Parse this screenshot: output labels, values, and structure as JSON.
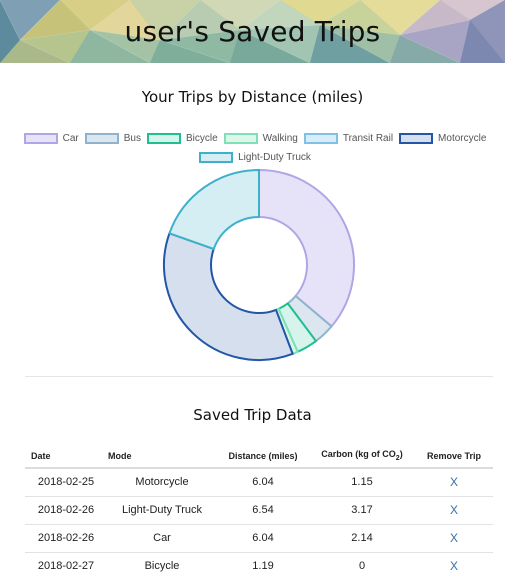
{
  "header": {
    "title": "user's Saved Trips"
  },
  "chart_section": {
    "title": "Your Trips by Distance (miles)"
  },
  "chart_data": {
    "type": "pie",
    "donut": true,
    "legend_position": "top",
    "categories": [
      "Car",
      "Bus",
      "Bicycle",
      "Walking",
      "Transit Rail",
      "Motorcycle",
      "Light-Duty Truck"
    ],
    "values": [
      12.08,
      1.2,
      1.19,
      0.3,
      0.0,
      12.08,
      6.54
    ],
    "colors": {
      "fill": [
        "#e6e3f8",
        "#dbe6ef",
        "#d6f4ec",
        "#dcf7ea",
        "#d9edf8",
        "#d5dfee",
        "#d5eef3"
      ],
      "stroke": [
        "#b0a6e6",
        "#8fb3cf",
        "#1fbf8f",
        "#7fe0b5",
        "#7ec1e6",
        "#2256a8",
        "#3fb0c9"
      ]
    }
  },
  "table_section": {
    "title": "Saved Trip Data"
  },
  "table": {
    "headers": {
      "date": "Date",
      "mode": "Mode",
      "distance": "Distance (miles)",
      "carbon_prefix": "Carbon (kg of CO",
      "carbon_sub": "2",
      "carbon_suffix": ")",
      "remove": "Remove Trip"
    },
    "rows": [
      {
        "date": "2018-02-25",
        "mode": "Motorcycle",
        "distance": "6.04",
        "carbon": "1.15",
        "remove": "X"
      },
      {
        "date": "2018-02-26",
        "mode": "Light-Duty Truck",
        "distance": "6.54",
        "carbon": "3.17",
        "remove": "X"
      },
      {
        "date": "2018-02-26",
        "mode": "Car",
        "distance": "6.04",
        "carbon": "2.14",
        "remove": "X"
      },
      {
        "date": "2018-02-27",
        "mode": "Bicycle",
        "distance": "1.19",
        "carbon": "0",
        "remove": "X"
      }
    ]
  }
}
